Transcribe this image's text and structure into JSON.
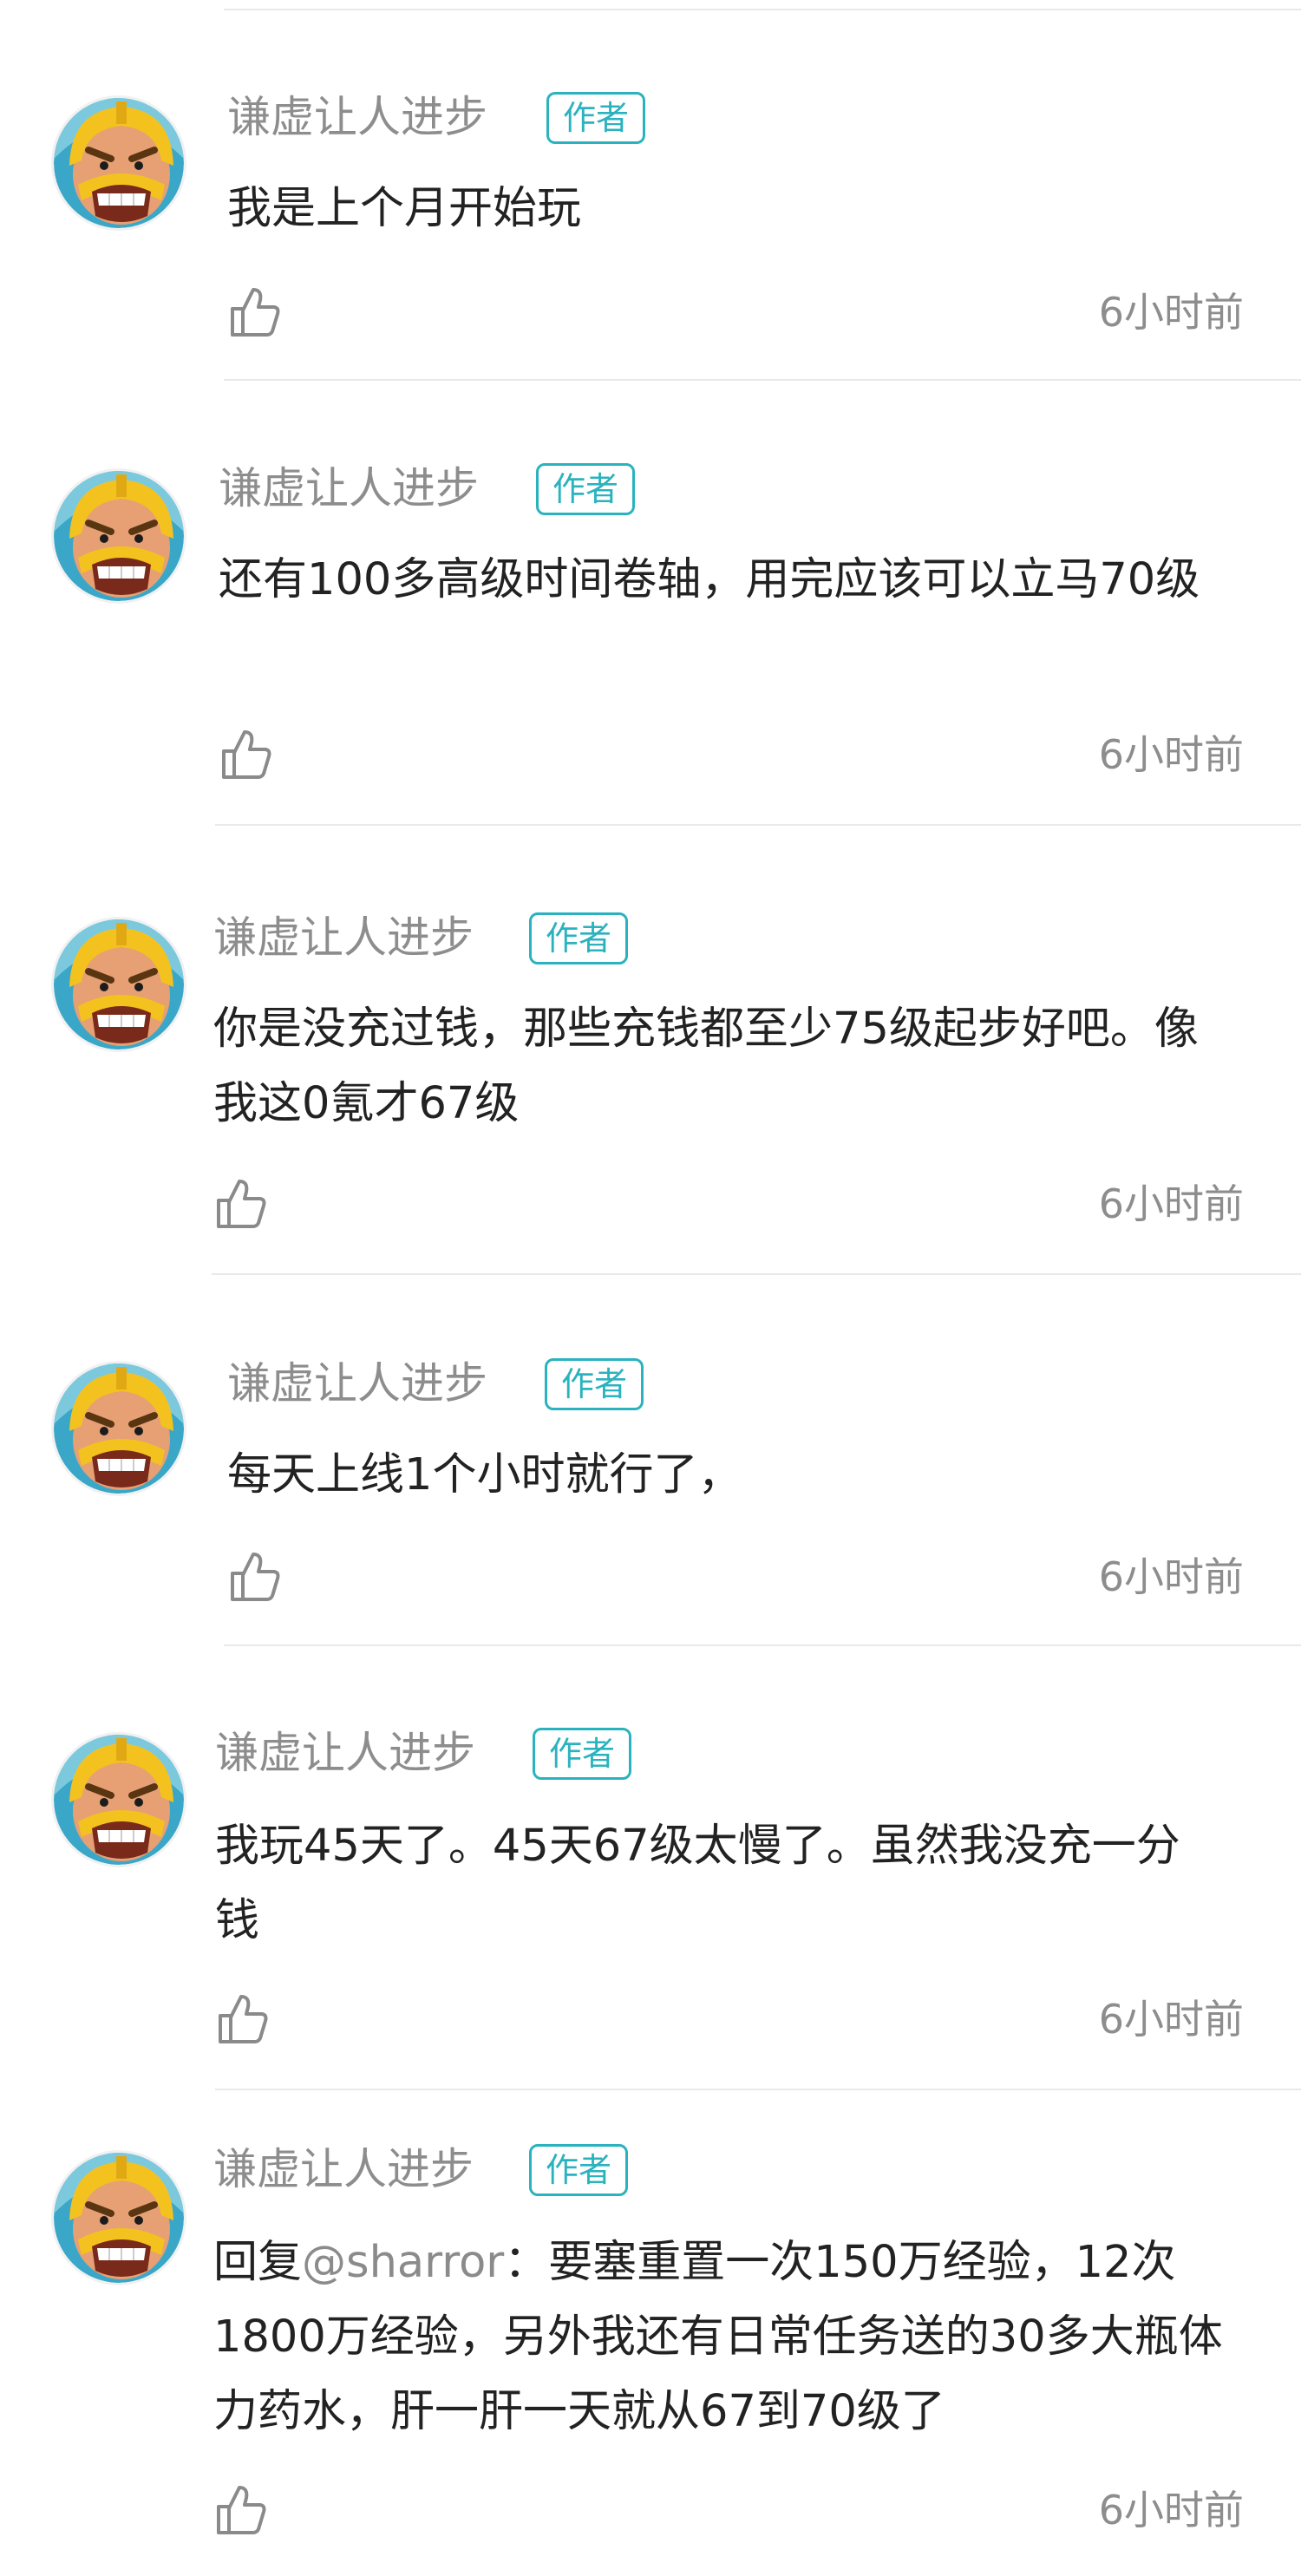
{
  "colors": {
    "accent": "#2ab3bf",
    "meta_text": "#8d8d8d",
    "body_text": "#222222",
    "divider": "#e9e9e9"
  },
  "icons": {
    "like": "thumbs-up-icon",
    "avatar": "barbarian-avatar"
  },
  "comments": [
    {
      "user": "谦虚让人进步",
      "badge": "作者",
      "text": "我是上个月开始玩",
      "time": "6小时前"
    },
    {
      "user": "谦虚让人进步",
      "badge": "作者",
      "text": "还有100多高级时间卷轴，用完应该可以立马70级",
      "time": "6小时前"
    },
    {
      "user": "谦虚让人进步",
      "badge": "作者",
      "text": "你是没充过钱，那些充钱都至少75级起步好吧。像我这0氪才67级",
      "time": "6小时前"
    },
    {
      "user": "谦虚让人进步",
      "badge": "作者",
      "text": "每天上线1个小时就行了，",
      "time": "6小时前"
    },
    {
      "user": "谦虚让人进步",
      "badge": "作者",
      "text": "我玩45天了。45天67级太慢了。虽然我没充一分钱",
      "time": "6小时前"
    },
    {
      "user": "谦虚让人进步",
      "badge": "作者",
      "reply_prefix": "回复",
      "mention": "@sharror",
      "text": "：要塞重置一次150万经验，12次1800万经验，另外我还有日常任务送的30多大瓶体力药水，肝一肝一天就从67到70级了",
      "time": "6小时前"
    }
  ]
}
